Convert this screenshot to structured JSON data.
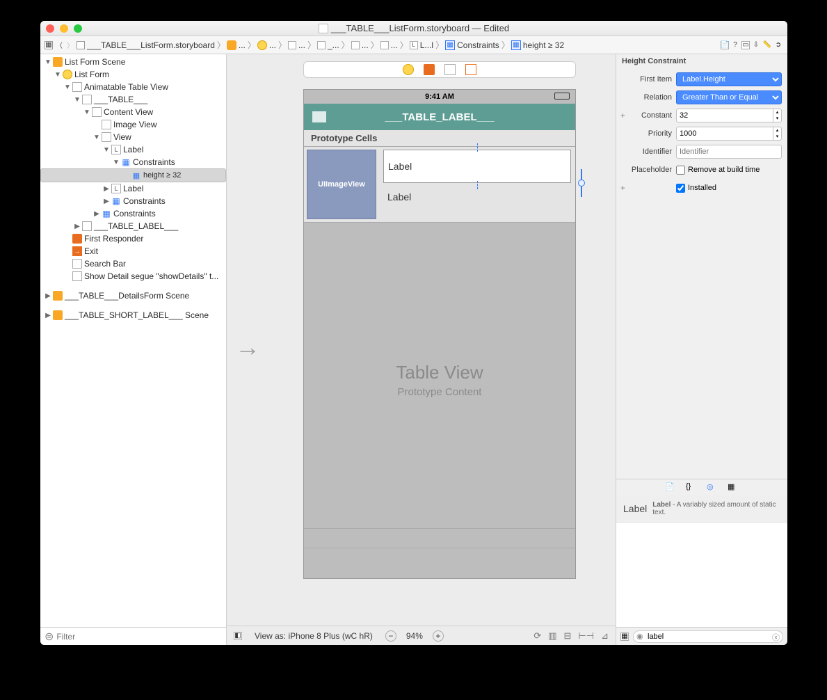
{
  "window": {
    "title": "___TABLE___ListForm.storyboard — Edited"
  },
  "crumbs": [
    {
      "icon": "grid",
      "label": ""
    },
    {
      "icon": "back",
      "label": ""
    },
    {
      "icon": "fwd",
      "label": ""
    },
    {
      "icon": "file",
      "label": "___TABLE___ListForm.storyboard"
    },
    {
      "icon": "scene",
      "label": "..."
    },
    {
      "icon": "circle",
      "label": "..."
    },
    {
      "icon": "view",
      "label": "..."
    },
    {
      "icon": "view",
      "label": "_..."
    },
    {
      "icon": "view",
      "label": "..."
    },
    {
      "icon": "view",
      "label": "..."
    },
    {
      "icon": "label",
      "label": "L...l"
    },
    {
      "icon": "constr",
      "label": "Constraints"
    },
    {
      "icon": "constr",
      "label": "height ≥ 32"
    }
  ],
  "tree": {
    "root": "List Form Scene",
    "rows": [
      {
        "d": 0,
        "open": true,
        "icon": "scene",
        "label": "List Form Scene"
      },
      {
        "d": 1,
        "open": true,
        "icon": "circle",
        "label": "List Form"
      },
      {
        "d": 2,
        "open": true,
        "icon": "view",
        "label": "Animatable Table View"
      },
      {
        "d": 3,
        "open": true,
        "icon": "view",
        "label": "___TABLE___"
      },
      {
        "d": 4,
        "open": true,
        "icon": "view",
        "label": "Content View"
      },
      {
        "d": 5,
        "open": false,
        "icon": "view",
        "label": "Image View"
      },
      {
        "d": 5,
        "open": true,
        "icon": "view",
        "label": "View"
      },
      {
        "d": 6,
        "open": true,
        "icon": "label",
        "label": "Label"
      },
      {
        "d": 7,
        "open": true,
        "icon": "constr",
        "label": "Constraints"
      },
      {
        "d": 8,
        "open": false,
        "icon": "constr",
        "label": "height ≥ 32",
        "sel": true
      },
      {
        "d": 6,
        "open": false,
        "icon": "label",
        "label": "Label"
      },
      {
        "d": 6,
        "open": false,
        "icon": "constr",
        "label": "Constraints"
      },
      {
        "d": 5,
        "open": false,
        "icon": "constr",
        "label": "Constraints"
      },
      {
        "d": 3,
        "open": false,
        "icon": "back-blue",
        "label": "___TABLE_LABEL___"
      },
      {
        "d": 2,
        "open": false,
        "icon": "first",
        "label": "First Responder"
      },
      {
        "d": 2,
        "open": false,
        "icon": "exit",
        "label": "Exit"
      },
      {
        "d": 2,
        "open": false,
        "icon": "view",
        "label": "Search Bar"
      },
      {
        "d": 2,
        "open": false,
        "icon": "segue",
        "label": "Show Detail segue \"showDetails\" t..."
      },
      {
        "d": 0,
        "open": false,
        "icon": "scene",
        "label": "___TABLE___DetailsForm Scene",
        "spaced": true
      },
      {
        "d": 0,
        "open": false,
        "icon": "scene",
        "label": "___TABLE_SHORT_LABEL___ Scene",
        "spaced": true
      }
    ],
    "filter_placeholder": "Filter"
  },
  "canvas": {
    "time": "9:41 AM",
    "header_title": "___TABLE_LABEL___",
    "proto_title": "Prototype Cells",
    "imgview": "UIImageView",
    "label1": "Label",
    "label2": "Label",
    "tv_title": "Table View",
    "tv_sub": "Prototype Content",
    "footer_device": "View as: iPhone 8 Plus (wC hR)",
    "zoom": "94%"
  },
  "inspector": {
    "title": "Height Constraint",
    "rows": {
      "first_item": {
        "label": "First Item",
        "value": "Label.Height"
      },
      "relation": {
        "label": "Relation",
        "value": "Greater Than or Equal"
      },
      "constant": {
        "label": "Constant",
        "value": "32"
      },
      "priority": {
        "label": "Priority",
        "value": "1000"
      },
      "identifier": {
        "label": "Identifier",
        "placeholder": "Identifier",
        "value": ""
      },
      "placeholder": {
        "label": "Placeholder",
        "checkbox_label": "Remove at build time",
        "checked": false
      },
      "installed": {
        "label": "Installed",
        "checked": true
      }
    }
  },
  "library": {
    "item_title": "Label",
    "item_short": "Label",
    "item_desc": " - A variably sized amount of static text.",
    "filter": "label"
  }
}
